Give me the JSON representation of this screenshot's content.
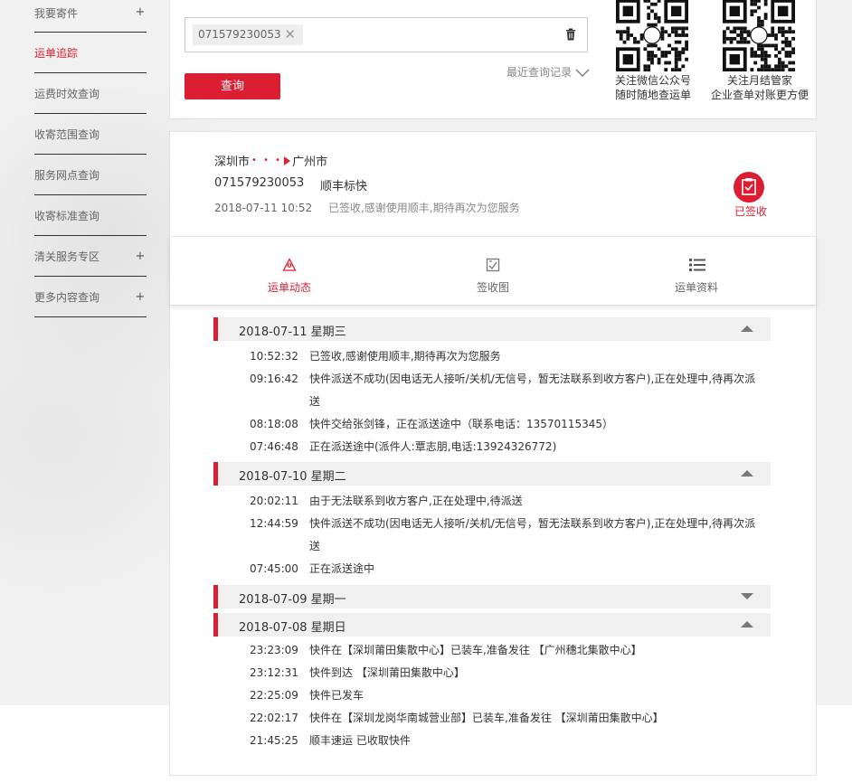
{
  "sidebar": {
    "items": [
      {
        "label": "我要寄件",
        "plus": "+"
      },
      {
        "label": "运单追踪",
        "plus": ""
      },
      {
        "label": "运费时效查询",
        "plus": ""
      },
      {
        "label": "收寄范围查询",
        "plus": ""
      },
      {
        "label": "服务网点查询",
        "plus": ""
      },
      {
        "label": "收寄标准查询",
        "plus": ""
      },
      {
        "label": "清关服务专区",
        "plus": "+"
      },
      {
        "label": "更多内容查询",
        "plus": "+"
      }
    ]
  },
  "query": {
    "tag_number": "071579230053",
    "tag_close": "✕",
    "recent_label": "最近查询记录",
    "query_button": "查询",
    "qr1_line1": "关注微信公众号",
    "qr1_line2": "随时随地查运单",
    "qr2_line1": "关注月结管家",
    "qr2_line2": "企业查单对账更方便"
  },
  "summary": {
    "origin": "深圳市",
    "dots": "• • •",
    "destination": "广州市",
    "waybill": "071579230053",
    "product": "顺丰标快",
    "latest_time": "2018-07-11 10:52",
    "latest_desc": "已签收,感谢使用顺丰,期待再次为您服务",
    "status_label": "已签收"
  },
  "tabs": [
    {
      "label": "运单动态"
    },
    {
      "label": "签收图"
    },
    {
      "label": "运单资料"
    }
  ],
  "timeline": [
    {
      "date": "2018-07-11 星期三",
      "events": [
        {
          "time": "10:52:32",
          "msg": "已签收,感谢使用顺丰,期待再次为您服务"
        },
        {
          "time": "09:16:42",
          "msg": "快件派送不成功(因电话无人接听/关机/无信号，暂无法联系到收方客户),正在处理中,待再次派",
          "msg2": "送"
        },
        {
          "time": "08:18:08",
          "msg": "快件交给张剑锋，正在派送途中（联系电话：13570115345）"
        },
        {
          "time": "07:46:48",
          "msg": "正在派送途中(派件人:覃志朋,电话:13924326772)"
        }
      ]
    },
    {
      "date": "2018-07-10 星期二",
      "events": [
        {
          "time": "20:02:11",
          "msg": "由于无法联系到收方客户,正在处理中,待派送"
        },
        {
          "time": "12:44:59",
          "msg": "快件派送不成功(因电话无人接听/关机/无信号，暂无法联系到收方客户),正在处理中,待再次派",
          "msg2": "送"
        },
        {
          "time": "07:45:00",
          "msg": "正在派送途中"
        }
      ]
    },
    {
      "date": "2018-07-09 星期一",
      "events": []
    },
    {
      "date": "2018-07-08 星期日",
      "events": [
        {
          "time": "23:23:09",
          "msg": "快件在【深圳莆田集散中心】已装车,准备发往 【广州穗北集散中心】"
        },
        {
          "time": "23:12:31",
          "msg": "快件到达 【深圳莆田集散中心】"
        },
        {
          "time": "22:25:09",
          "msg": "快件已发车"
        },
        {
          "time": "22:02:17",
          "msg": "快件在【深圳龙岗华南城营业部】已装车,准备发往 【深圳莆田集散中心】"
        },
        {
          "time": "21:45:25",
          "msg": "顺丰速运 已收取快件"
        }
      ]
    }
  ]
}
